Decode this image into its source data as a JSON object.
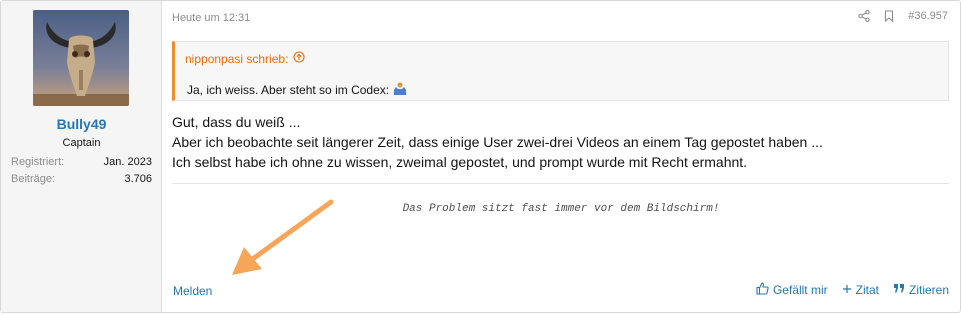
{
  "user": {
    "name": "Bully49",
    "title": "Captain",
    "stats": [
      {
        "label": "Registriert:",
        "value": "Jan. 2023"
      },
      {
        "label": "Beiträge:",
        "value": "3.706"
      }
    ]
  },
  "post": {
    "date": "Heute um 12:31",
    "number": "#36.957"
  },
  "quote": {
    "author": "nipponpasi schrieb:",
    "text": "Ja, ich weiss. Aber steht so im Codex:"
  },
  "body": {
    "lines": [
      "Gut, dass du weiß ...",
      "Aber ich beobachte seit längerer Zeit, dass einige User zwei-drei Videos an einem Tag gepostet haben ...",
      "Ich selbst habe ich ohne zu wissen, zweimal gepostet, und prompt wurde mit Recht ermahnt."
    ]
  },
  "signature": "Das Problem sitzt fast immer vor dem Bildschirm!",
  "actions": {
    "report": "Melden",
    "like": "Gefällt mir",
    "quote_plus": "Zitat",
    "reply_quote": "Zitieren"
  },
  "colors": {
    "link": "#2577b1",
    "quote_accent": "#f78c2b",
    "arrow": "#f5a658"
  }
}
